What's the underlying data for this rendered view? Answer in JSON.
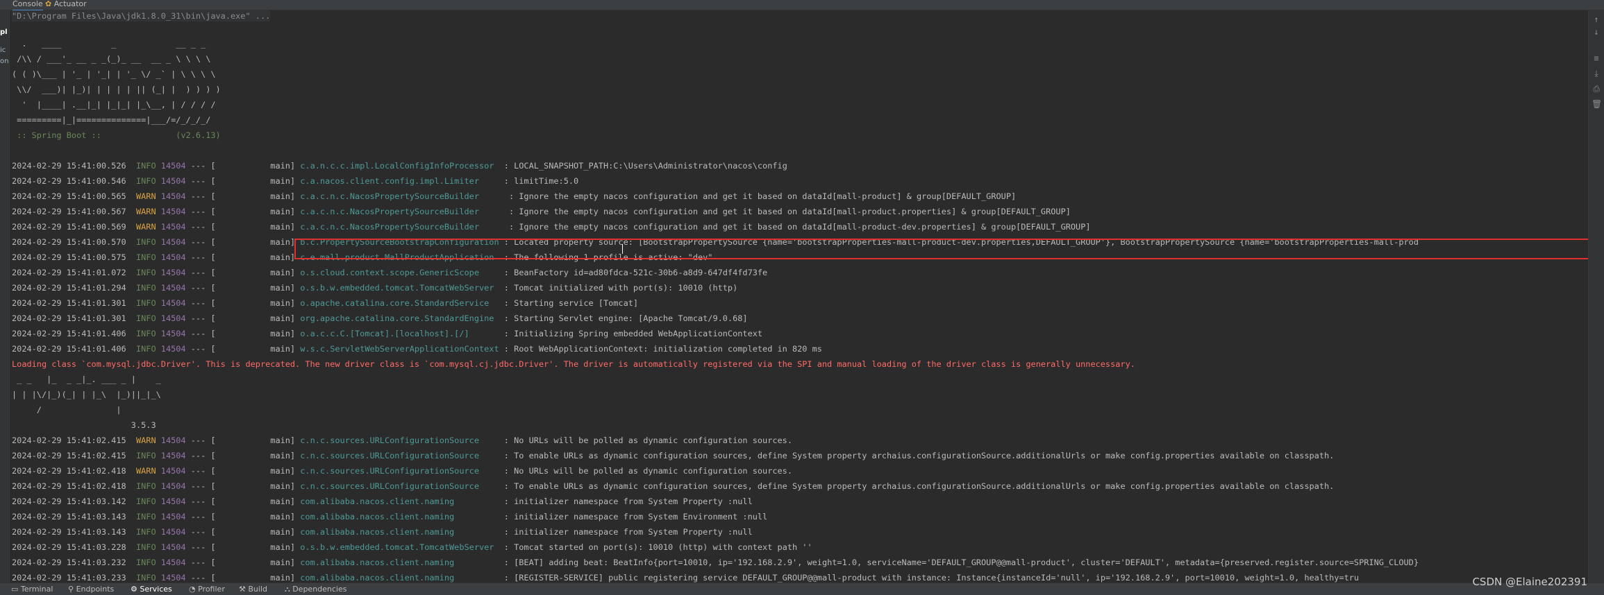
{
  "tabs": [
    {
      "label": "Console",
      "active": true
    },
    {
      "label": "Actuator",
      "active": false
    }
  ],
  "gutter_labels": [
    "pl",
    "ic",
    "on"
  ],
  "console": {
    "command_line": "\"D:\\Program Files\\Java\\jdk1.8.0_31\\bin\\java.exe\" ...",
    "spring_banner": [
      "  .   ____          _            __ _ _",
      " /\\\\ / ___'_ __ _ _(_)_ __  __ _ \\ \\ \\ \\",
      "( ( )\\___ | '_ | '_| | '_ \\/ _` | \\ \\ \\ \\",
      " \\\\/  ___)| |_)| | | | | || (_| |  ) ) ) )",
      "  '  |____| .__|_| |_|_| |_\\__, | / / / /",
      " =========|_|==============|___/=/_/_/_/"
    ],
    "spring_boot_line": " :: Spring Boot ::               (v2.6.13)",
    "log_lines_1": [
      {
        "ts": "2024-02-29 15:41:00.526",
        "level": "INFO",
        "pid": "14504",
        "sep": " --- [           main]",
        "logger": "c.a.n.c.c.impl.LocalConfigInfoProcessor ",
        "msg": " : LOCAL_SNAPSHOT_PATH:C:\\Users\\Administrator\\nacos\\config"
      },
      {
        "ts": "2024-02-29 15:41:00.546",
        "level": "INFO",
        "pid": "14504",
        "sep": " --- [           main]",
        "logger": "c.a.nacos.client.config.impl.Limiter    ",
        "msg": " : limitTime:5.0"
      },
      {
        "ts": "2024-02-29 15:41:00.565",
        "level": "WARN",
        "pid": "14504",
        "sep": " --- [           main]",
        "logger": "c.a.c.n.c.NacosPropertySourceBuilder     ",
        "msg": " : Ignore the empty nacos configuration and get it based on dataId[mall-product] & group[DEFAULT_GROUP]"
      },
      {
        "ts": "2024-02-29 15:41:00.567",
        "level": "WARN",
        "pid": "14504",
        "sep": " --- [           main]",
        "logger": "c.a.c.n.c.NacosPropertySourceBuilder     ",
        "msg": " : Ignore the empty nacos configuration and get it based on dataId[mall-product.properties] & group[DEFAULT_GROUP]"
      },
      {
        "ts": "2024-02-29 15:41:00.569",
        "level": "WARN",
        "pid": "14504",
        "sep": " --- [           main]",
        "logger": "c.a.c.n.c.NacosPropertySourceBuilder     ",
        "msg": " : Ignore the empty nacos configuration and get it based on dataId[mall-product-dev.properties] & group[DEFAULT_GROUP]"
      },
      {
        "ts": "2024-02-29 15:41:00.570",
        "level": "INFO",
        "pid": "14504",
        "sep": " --- [           main]",
        "logger": "b.c.PropertySourceBootstrapConfiguration",
        "msg": " : Located property source: [BootstrapPropertySource {name='bootstrapProperties-mall-product-dev.properties,DEFAULT_GROUP'}, BootstrapPropertySource {name='bootstrapProperties-mall-prod"
      },
      {
        "ts": "2024-02-29 15:41:00.575",
        "level": "INFO",
        "pid": "14504",
        "sep": " --- [           main]",
        "logger": "c.e.mall.product.MallProductApplication ",
        "msg": " : The following 1 profile is active: \"dev\""
      },
      {
        "ts": "2024-02-29 15:41:01.072",
        "level": "INFO",
        "pid": "14504",
        "sep": " --- [           main]",
        "logger": "o.s.cloud.context.scope.GenericScope    ",
        "msg": " : BeanFactory id=ad80fdca-521c-30b6-a8d9-647df4fd73fe"
      },
      {
        "ts": "2024-02-29 15:41:01.294",
        "level": "INFO",
        "pid": "14504",
        "sep": " --- [           main]",
        "logger": "o.s.b.w.embedded.tomcat.TomcatWebServer ",
        "msg": " : Tomcat initialized with port(s): 10010 (http)"
      },
      {
        "ts": "2024-02-29 15:41:01.301",
        "level": "INFO",
        "pid": "14504",
        "sep": " --- [           main]",
        "logger": "o.apache.catalina.core.StandardService  ",
        "msg": " : Starting service [Tomcat]"
      },
      {
        "ts": "2024-02-29 15:41:01.301",
        "level": "INFO",
        "pid": "14504",
        "sep": " --- [           main]",
        "logger": "org.apache.catalina.core.StandardEngine ",
        "msg": " : Starting Servlet engine: [Apache Tomcat/9.0.68]"
      },
      {
        "ts": "2024-02-29 15:41:01.406",
        "level": "INFO",
        "pid": "14504",
        "sep": " --- [           main]",
        "logger": "o.a.c.c.C.[Tomcat].[localhost].[/]      ",
        "msg": " : Initializing Spring embedded WebApplicationContext"
      },
      {
        "ts": "2024-02-29 15:41:01.406",
        "level": "INFO",
        "pid": "14504",
        "sep": " --- [           main]",
        "logger": "w.s.c.ServletWebServerApplicationContext",
        "msg": " : Root WebApplicationContext: initialization completed in 820 ms"
      }
    ],
    "driver_warning": "Loading class `com.mysql.jdbc.Driver'. This is deprecated. The new driver class is `com.mysql.cj.jdbc.Driver'. The driver is automatically registered via the SPI and manual loading of the driver class is generally unnecessary.",
    "mybatis_banner": [
      " _ _   |_  _ _|_. ___ _ |    _",
      "| | |\\/|_)(_| | |_\\  |_)||_|_\\",
      "     /               |",
      "                        3.5.3"
    ],
    "log_lines_2": [
      {
        "ts": "2024-02-29 15:41:02.415",
        "level": "WARN",
        "pid": "14504",
        "sep": " --- [           main]",
        "logger": "c.n.c.sources.URLConfigurationSource    ",
        "msg": " : No URLs will be polled as dynamic configuration sources."
      },
      {
        "ts": "2024-02-29 15:41:02.415",
        "level": "INFO",
        "pid": "14504",
        "sep": " --- [           main]",
        "logger": "c.n.c.sources.URLConfigurationSource    ",
        "msg": " : To enable URLs as dynamic configuration sources, define System property archaius.configurationSource.additionalUrls or make config.properties available on classpath."
      },
      {
        "ts": "2024-02-29 15:41:02.418",
        "level": "WARN",
        "pid": "14504",
        "sep": " --- [           main]",
        "logger": "c.n.c.sources.URLConfigurationSource    ",
        "msg": " : No URLs will be polled as dynamic configuration sources."
      },
      {
        "ts": "2024-02-29 15:41:02.418",
        "level": "INFO",
        "pid": "14504",
        "sep": " --- [           main]",
        "logger": "c.n.c.sources.URLConfigurationSource    ",
        "msg": " : To enable URLs as dynamic configuration sources, define System property archaius.configurationSource.additionalUrls or make config.properties available on classpath."
      },
      {
        "ts": "2024-02-29 15:41:03.142",
        "level": "INFO",
        "pid": "14504",
        "sep": " --- [           main]",
        "logger": "com.alibaba.nacos.client.naming         ",
        "msg": " : initializer namespace from System Property :null"
      },
      {
        "ts": "2024-02-29 15:41:03.143",
        "level": "INFO",
        "pid": "14504",
        "sep": " --- [           main]",
        "logger": "com.alibaba.nacos.client.naming         ",
        "msg": " : initializer namespace from System Environment :null"
      },
      {
        "ts": "2024-02-29 15:41:03.143",
        "level": "INFO",
        "pid": "14504",
        "sep": " --- [           main]",
        "logger": "com.alibaba.nacos.client.naming         ",
        "msg": " : initializer namespace from System Property :null"
      },
      {
        "ts": "2024-02-29 15:41:03.228",
        "level": "INFO",
        "pid": "14504",
        "sep": " --- [           main]",
        "logger": "o.s.b.w.embedded.tomcat.TomcatWebServer ",
        "msg": " : Tomcat started on port(s): 10010 (http) with context path ''"
      },
      {
        "ts": "2024-02-29 15:41:03.232",
        "level": "INFO",
        "pid": "14504",
        "sep": " --- [           main]",
        "logger": "com.alibaba.nacos.client.naming         ",
        "msg": " : [BEAT] adding beat: BeatInfo{port=10010, ip='192.168.2.9', weight=1.0, serviceName='DEFAULT_GROUP@@mall-product', cluster='DEFAULT', metadata={preserved.register.source=SPRING_CLOUD}"
      },
      {
        "ts": "2024-02-29 15:41:03.233",
        "level": "INFO",
        "pid": "14504",
        "sep": " --- [           main]",
        "logger": "com.alibaba.nacos.client.naming         ",
        "msg": " : [REGISTER-SERVICE] public registering service DEFAULT_GROUP@@mall-product with instance: Instance{instanceId='null', ip='192.168.2.9', port=10010, weight=1.0, healthy=tru"
      }
    ]
  },
  "bottom_tabs": [
    "Terminal",
    "Endpoints",
    "Services",
    "Profiler",
    "Build",
    "Dependencies"
  ],
  "watermark": "CSDN @Elaine202391",
  "colors": {
    "info": "#6a8759",
    "warn": "#d9a343",
    "pid": "#9876aa",
    "logger": "#4e9a98",
    "error": "#ff6b68",
    "highlight_box": "#e0312f"
  }
}
